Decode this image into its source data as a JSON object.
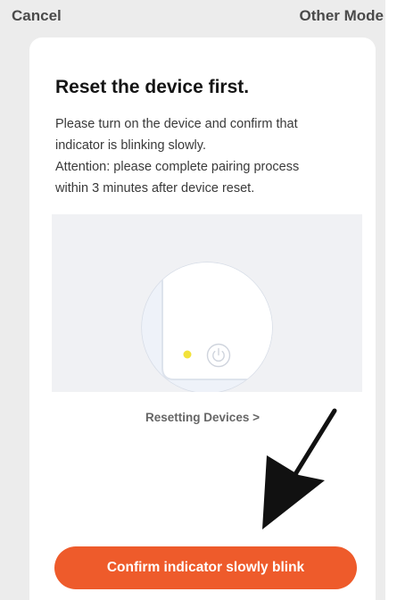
{
  "top_bar": {
    "cancel_label": "Cancel",
    "other_mode_label": "Other Mode"
  },
  "card": {
    "title": "Reset the device first.",
    "description_lines": [
      "Please turn on the device and confirm that",
      "indicator is blinking slowly.",
      "Attention: please complete pairing process",
      "within 3 minutes after device reset."
    ],
    "reset_link_label": "Resetting Devices >",
    "confirm_button_label": "Confirm indicator slowly blink"
  },
  "colors": {
    "accent": "#ee5b2b",
    "indicator_light": "#f2e23a",
    "page_background": "#ececec",
    "card_background": "#ffffff",
    "illustration_background": "#f0f1f4"
  },
  "icons": {
    "power": "power-icon",
    "indicator": "indicator-light-icon",
    "arrow": "arrow-annotation-icon"
  }
}
